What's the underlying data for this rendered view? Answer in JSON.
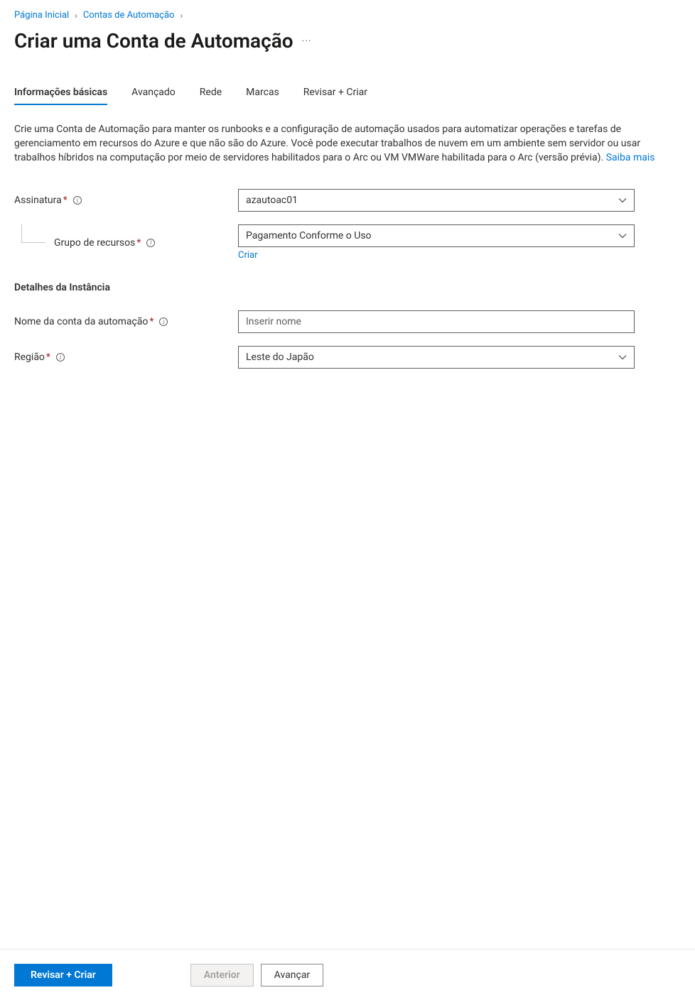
{
  "breadcrumb": {
    "items": [
      {
        "label": "Página Inicial"
      },
      {
        "label": "Contas de Automação"
      }
    ]
  },
  "header": {
    "title": "Criar uma Conta de Automação"
  },
  "tabs": [
    {
      "label": "Informações básicas",
      "active": true
    },
    {
      "label": "Avançado",
      "active": false
    },
    {
      "label": "Rede",
      "active": false
    },
    {
      "label": "Marcas",
      "active": false
    },
    {
      "label": "Revisar + Criar",
      "active": false
    }
  ],
  "intro": {
    "text": "Crie uma Conta de Automação para manter os runbooks e a configuração de automação usados para automatizar operações e tarefas de gerenciamento em recursos do Azure e que não são do Azure. Você pode executar trabalhos de nuvem em um ambiente sem servidor ou usar trabalhos híbridos na computação por meio de servidores habilitados para o Arc ou VM VMWare habilitada para o Arc (versão prévia). ",
    "link_label": "Saiba mais"
  },
  "form": {
    "subscription": {
      "label": "Assinatura",
      "value": "azautoac01"
    },
    "resource_group": {
      "label": "Grupo de recursos",
      "value": "Pagamento Conforme o Uso",
      "create_label": "Criar"
    },
    "section_instance": "Detalhes da Instância",
    "account_name": {
      "label": "Nome da conta da automação",
      "placeholder": "Inserir nome",
      "value": ""
    },
    "region": {
      "label": "Região",
      "value": "Leste do Japão"
    }
  },
  "footer": {
    "review_create": "Revisar + Criar",
    "previous": "Anterior",
    "next": "Avançar"
  }
}
